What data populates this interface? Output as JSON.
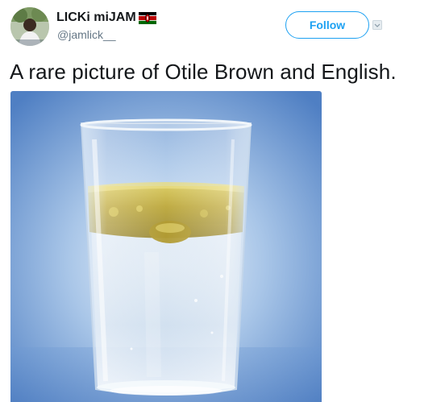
{
  "tweet": {
    "author": {
      "display_name": "LICKi miJAM",
      "handle": "@jamlick__",
      "flag": "kenya-flag"
    },
    "follow_label": "Follow",
    "text": "A rare picture of Otile Brown and English.",
    "photo": {
      "subject": "glass-of-water-and-oil"
    }
  },
  "colors": {
    "accent": "#1da1f2",
    "text": "#14171a",
    "secondary": "#657786"
  }
}
